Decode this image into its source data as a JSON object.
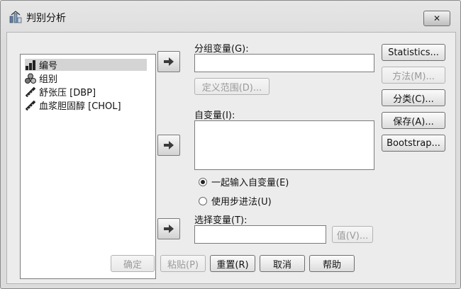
{
  "window": {
    "title": "判别分析",
    "close_glyph": "✕"
  },
  "variable_list": [
    {
      "label": "编号",
      "icon": "scale-ruler-icon",
      "selected": true
    },
    {
      "label": "组别",
      "icon": "nominal-balls-icon",
      "selected": false
    },
    {
      "label": "舒张压 [DBP]",
      "icon": "scale-ruler-icon",
      "selected": false
    },
    {
      "label": "血浆胆固醇 [CHOL]",
      "icon": "scale-ruler-icon",
      "selected": false
    }
  ],
  "grouping": {
    "label": "分组变量(G):",
    "value": "",
    "define_range_label": "定义范围(D)..."
  },
  "independents": {
    "label": "自变量(I):",
    "value": "",
    "method_options": [
      {
        "label": "一起输入自变量(E)",
        "checked": true
      },
      {
        "label": "使用步进法(U)",
        "checked": false
      }
    ]
  },
  "selection": {
    "label": "选择变量(T):",
    "value": "",
    "value_button_label": "值(V)..."
  },
  "side_buttons": [
    {
      "label": "Statistics...",
      "enabled": true
    },
    {
      "label": "方法(M)...",
      "enabled": false
    },
    {
      "label": "分类(C)...",
      "enabled": true
    },
    {
      "label": "保存(A)...",
      "enabled": true
    },
    {
      "label": "Bootstrap...",
      "enabled": true
    }
  ],
  "bottom_buttons": [
    {
      "label": "确定",
      "enabled": false
    },
    {
      "label": "粘贴(P)",
      "enabled": false
    },
    {
      "label": "重置(R)",
      "enabled": true
    },
    {
      "label": "取消",
      "enabled": true
    },
    {
      "label": "帮助",
      "enabled": true
    }
  ]
}
